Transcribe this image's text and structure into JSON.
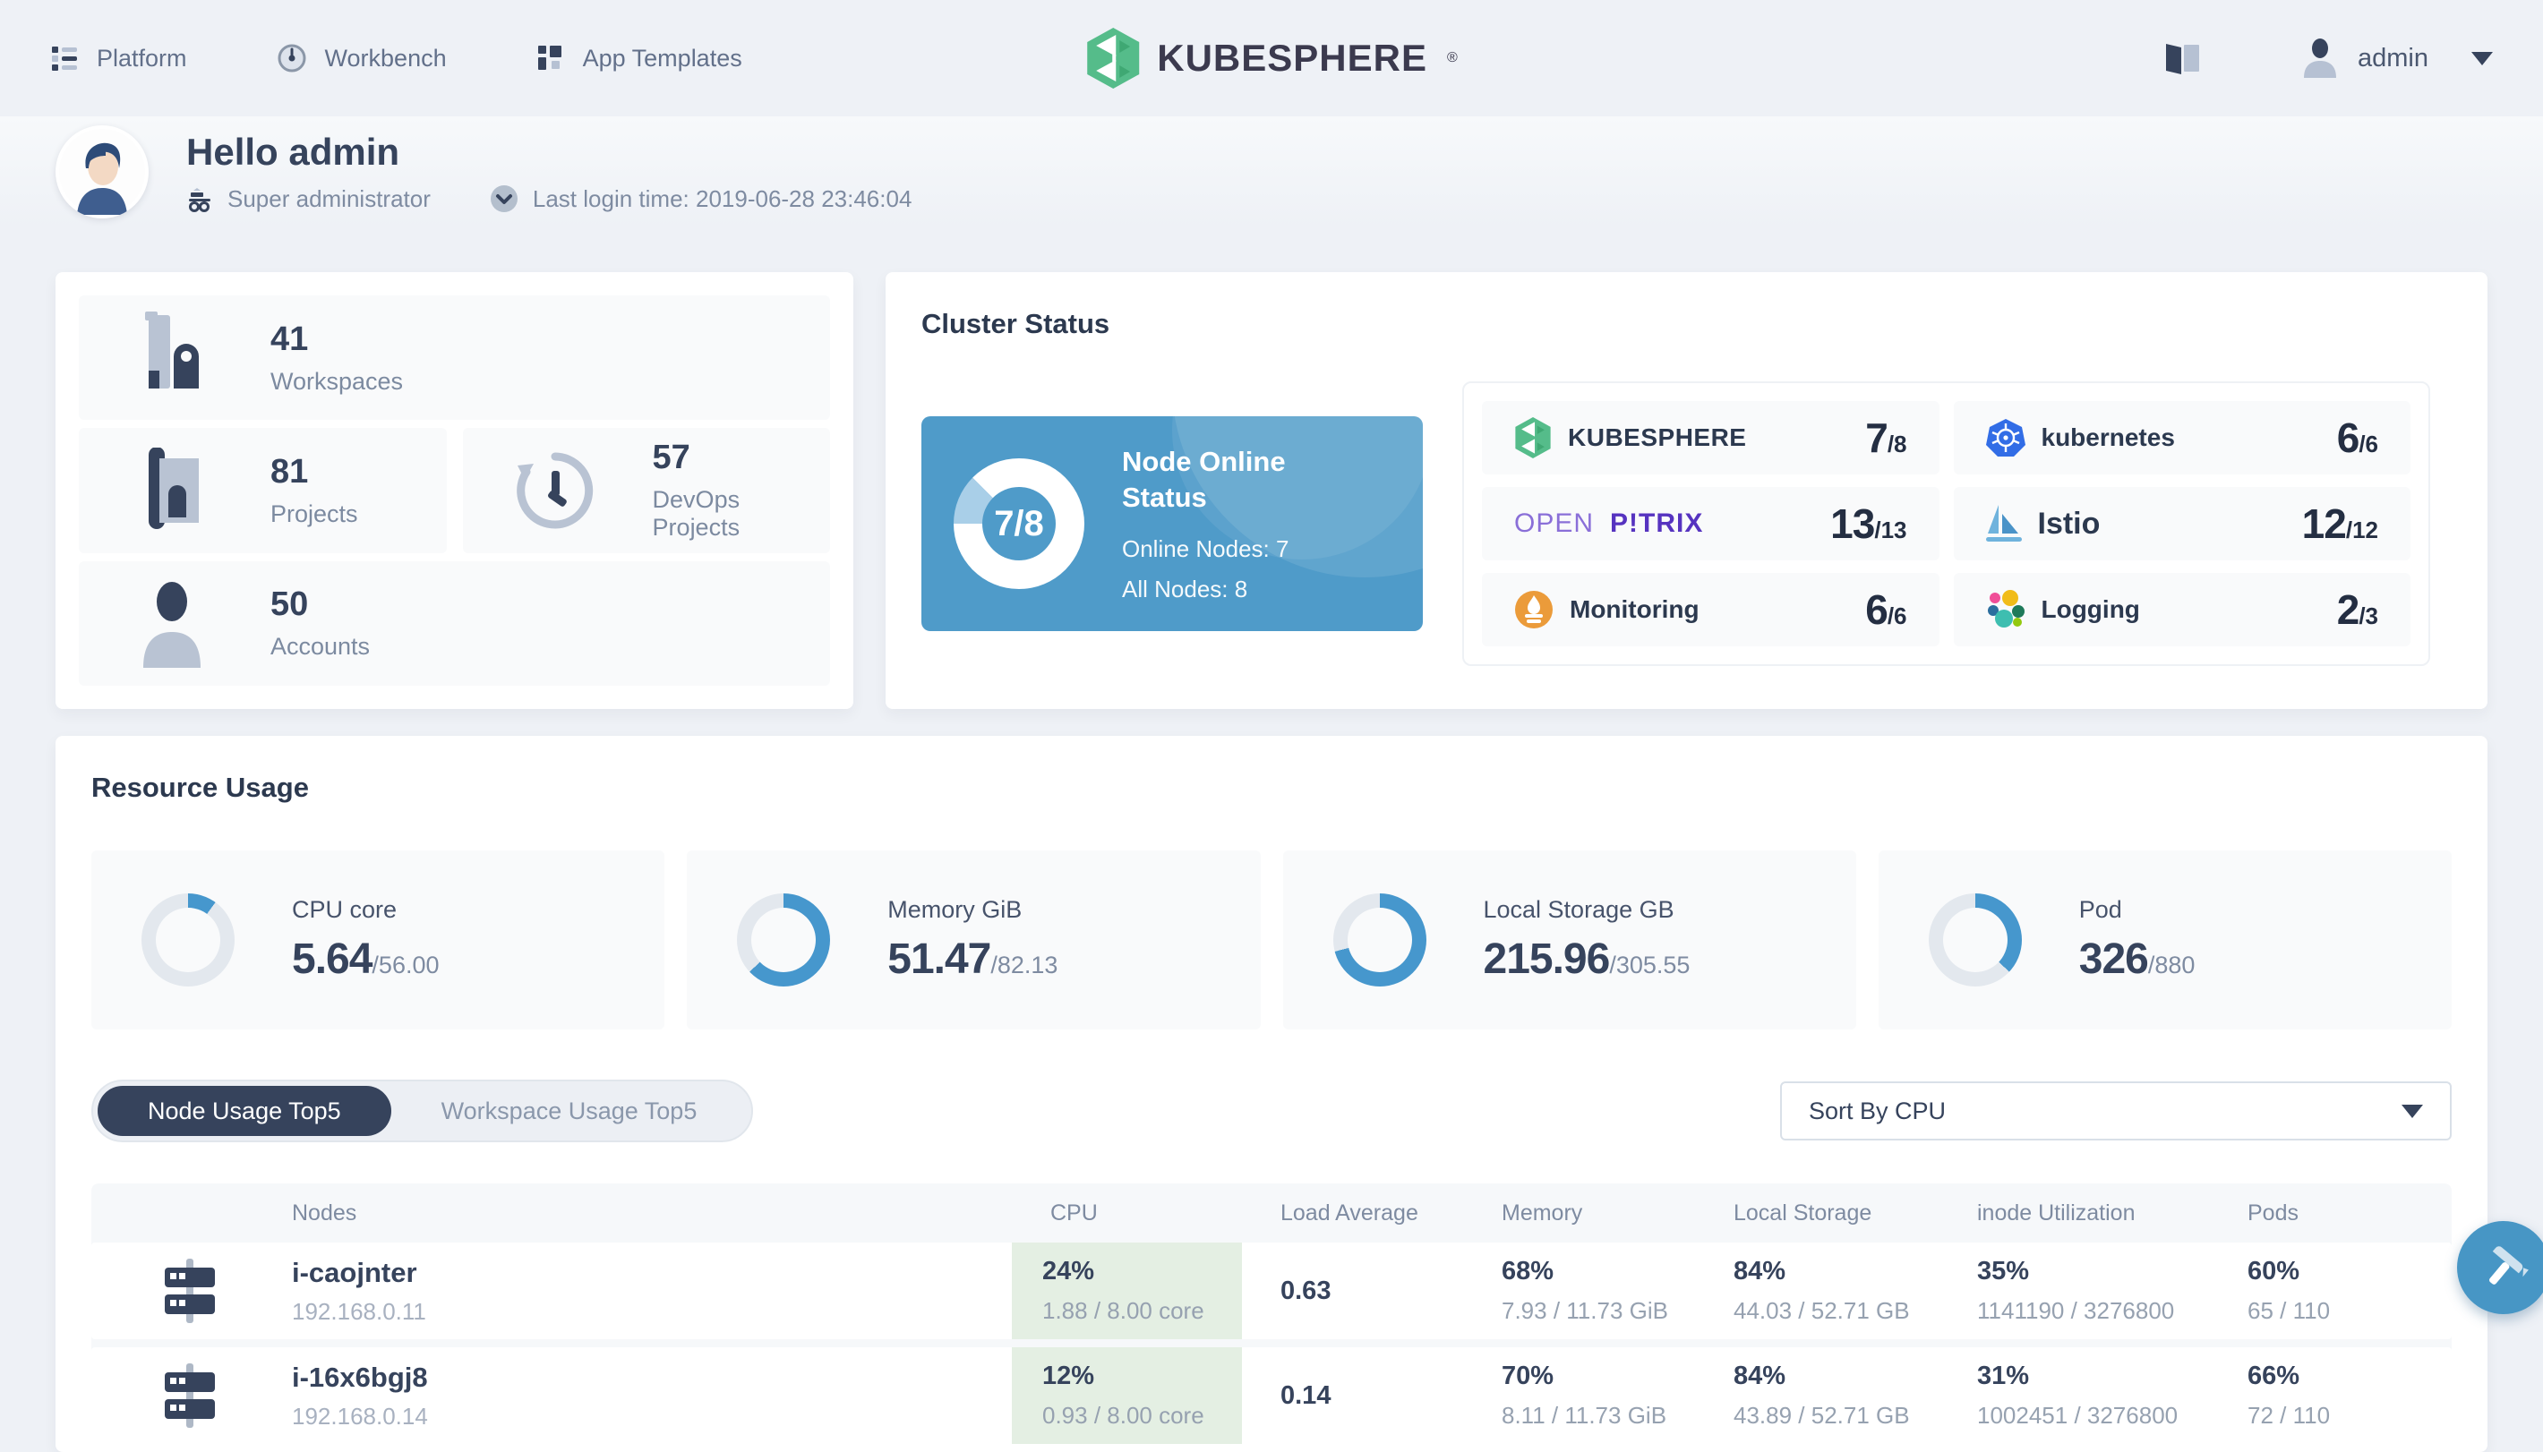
{
  "nav": {
    "platform": "Platform",
    "workbench": "Workbench",
    "app_templates": "App Templates",
    "logo_text": "KUBESPHERE",
    "logo_reg": "®",
    "username": "admin"
  },
  "header": {
    "greeting": "Hello admin",
    "role": "Super administrator",
    "last_login": "Last login time: 2019-06-28 23:46:04"
  },
  "stats": [
    {
      "value": "41",
      "label": "Workspaces"
    },
    {
      "value": "81",
      "label": "Projects"
    },
    {
      "value": "57",
      "label": "DevOps Projects"
    },
    {
      "value": "50",
      "label": "Accounts"
    }
  ],
  "cluster": {
    "title": "Cluster Status",
    "node_online": {
      "fraction": "7/8",
      "title": "Node Online Status",
      "online_label": "Online Nodes: 7",
      "all_label": "All Nodes: 8",
      "pct": 87.5
    },
    "services": [
      {
        "name": "KUBESPHERE",
        "value": "7",
        "total": "/8"
      },
      {
        "name": "kubernetes",
        "value": "6",
        "total": "/6"
      },
      {
        "name_prefix": "OPEN",
        "name_suffix": "P!TRIX",
        "value": "13",
        "total": "/13"
      },
      {
        "name": "Istio",
        "value": "12",
        "total": "/12"
      },
      {
        "name": "Monitoring",
        "value": "6",
        "total": "/6"
      },
      {
        "name": "Logging",
        "value": "2",
        "total": "/3"
      }
    ]
  },
  "resource": {
    "title": "Resource Usage",
    "gauges": [
      {
        "label": "CPU core",
        "used": "5.64",
        "total": "/56.00",
        "pct": 10
      },
      {
        "label": "Memory GiB",
        "used": "51.47",
        "total": "/82.13",
        "pct": 63
      },
      {
        "label": "Local Storage GB",
        "used": "215.96",
        "total": "/305.55",
        "pct": 71
      },
      {
        "label": "Pod",
        "used": "326",
        "total": "/880",
        "pct": 37
      }
    ],
    "tabs": [
      {
        "label": "Node Usage Top5"
      },
      {
        "label": "Workspace Usage Top5"
      }
    ],
    "sort_label": "Sort By CPU"
  },
  "table": {
    "headers": [
      "Nodes",
      "CPU",
      "Load Average",
      "Memory",
      "Local Storage",
      "inode Utilization",
      "Pods"
    ],
    "rows": [
      {
        "name": "i-caojnter",
        "ip": "192.168.0.11",
        "cpu_pct": "24%",
        "cpu_detail": "1.88 / 8.00 core",
        "load": "0.63",
        "memory_pct": "68%",
        "memory_detail": "7.93 / 11.73 GiB",
        "storage_pct": "84%",
        "storage_detail": "44.03 / 52.71 GB",
        "inode_pct": "35%",
        "inode_detail": "1141190 / 3276800",
        "pods_pct": "60%",
        "pods_detail": "65 / 110"
      },
      {
        "name": "i-16x6bgj8",
        "ip": "192.168.0.14",
        "cpu_pct": "12%",
        "cpu_detail": "0.93 / 8.00 core",
        "load": "0.14",
        "memory_pct": "70%",
        "memory_detail": "8.11 / 11.73 GiB",
        "storage_pct": "84%",
        "storage_detail": "43.89 / 52.71 GB",
        "inode_pct": "31%",
        "inode_detail": "1002451 / 3276800",
        "pods_pct": "66%",
        "pods_detail": "72 / 110"
      }
    ]
  },
  "colors": {
    "accent_blue": "#4f9bc9",
    "gauge_blue": "#4697cd",
    "gauge_track": "#e3e8ee",
    "node_donut_track": "#a9cfe8",
    "brand_green": "#55bc8a",
    "dark": "#36435c",
    "cpu_cell_green": "#e4efe3"
  }
}
